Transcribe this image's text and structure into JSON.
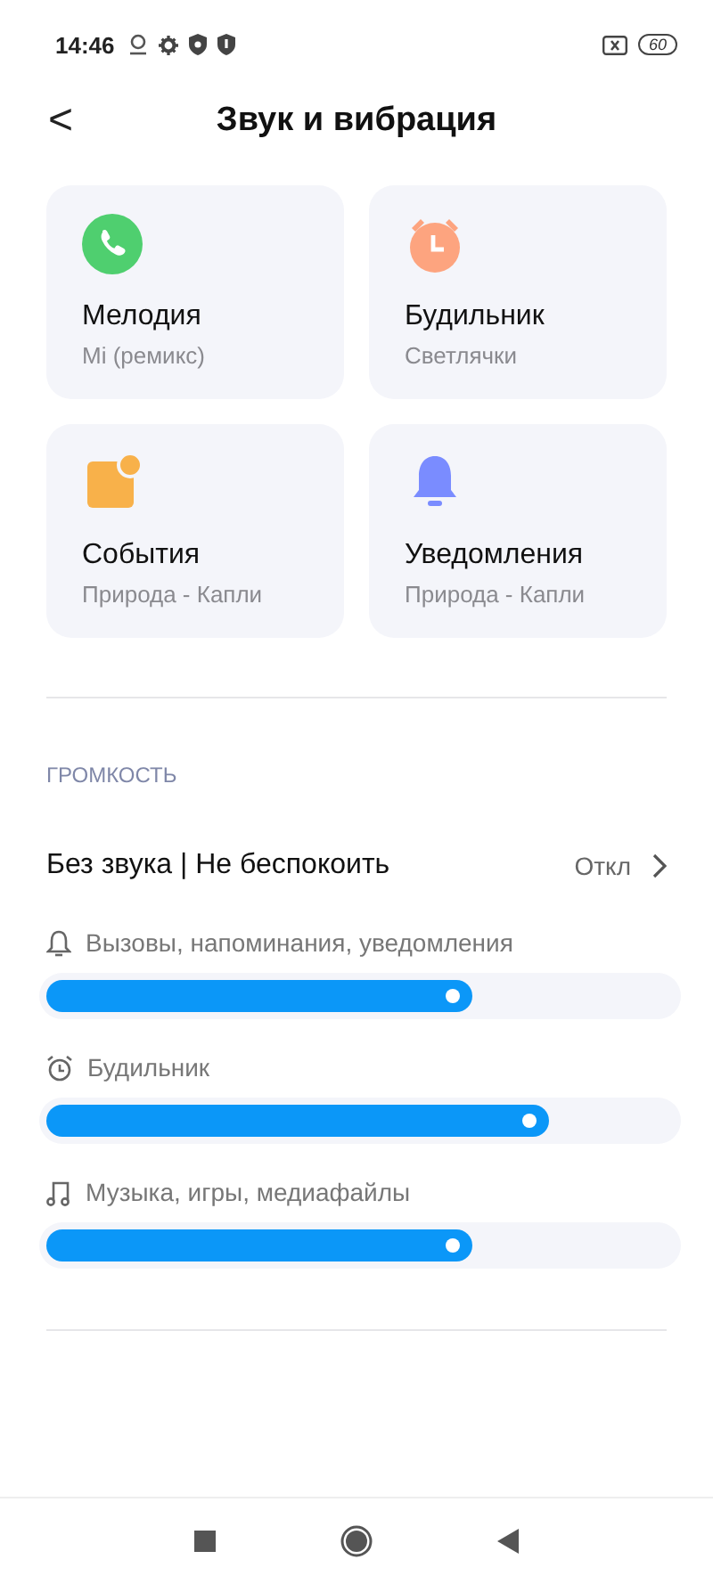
{
  "status_bar": {
    "time": "14:46",
    "battery": "60"
  },
  "header": {
    "back": "<",
    "title": "Звук и вибрация"
  },
  "cards": [
    {
      "kind": "phone",
      "title": "Мелодия",
      "subtitle": "Mi (ремикс)"
    },
    {
      "kind": "alarm",
      "title": "Будильник",
      "subtitle": "Светлячки"
    },
    {
      "kind": "event",
      "title": "События",
      "subtitle": "Природа - Капли"
    },
    {
      "kind": "bell",
      "title": "Уведомления",
      "subtitle": "Природа - Капли"
    }
  ],
  "volume_section": {
    "heading": "ГРОМКОСТЬ",
    "dnd": {
      "label": "Без звука | Не беспокоить",
      "value": "Откл"
    },
    "sliders": [
      {
        "kind": "bell",
        "label": "Вызовы, напоминания, уведомления",
        "level": 0.68
      },
      {
        "kind": "alarm",
        "label": "Будильник",
        "level": 0.8
      },
      {
        "kind": "music",
        "label": "Музыка, игры, медиафайлы",
        "level": 0.68
      }
    ]
  }
}
